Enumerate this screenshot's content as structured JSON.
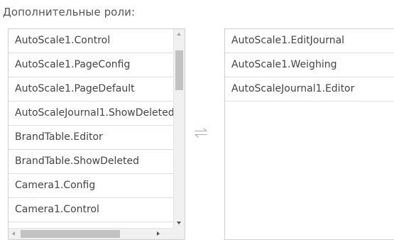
{
  "section": {
    "title": "Дополнительные роли:"
  },
  "available_roles": {
    "items": [
      {
        "label": "AutoScale1.Control"
      },
      {
        "label": "AutoScale1.PageConfig"
      },
      {
        "label": "AutoScale1.PageDefault"
      },
      {
        "label": "AutoScaleJournal1.ShowDeleted"
      },
      {
        "label": "BrandTable.Editor"
      },
      {
        "label": "BrandTable.ShowDeleted"
      },
      {
        "label": "Camera1.Config"
      },
      {
        "label": "Camera1.Control"
      }
    ]
  },
  "assigned_roles": {
    "items": [
      {
        "label": "AutoScale1.EditJournal"
      },
      {
        "label": "AutoScale1.Weighing"
      },
      {
        "label": "AutoScaleJournal1.Editor"
      }
    ]
  },
  "icons": {
    "swap": "swap-arrows-icon",
    "scroll_up": "scroll-up-arrow-icon",
    "scroll_down": "scroll-down-arrow-icon",
    "scroll_left": "scroll-left-arrow-icon",
    "scroll_right": "scroll-right-arrow-icon"
  },
  "colors": {
    "text": "#444444",
    "border": "#cfcfcf",
    "scroll_thumb": "#c2c2c2"
  }
}
